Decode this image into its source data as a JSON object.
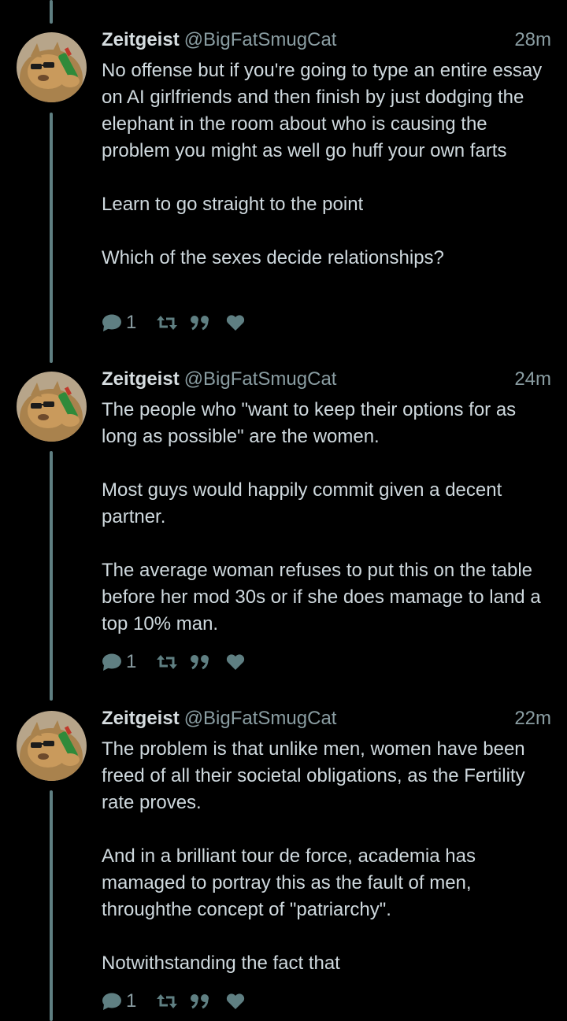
{
  "theme": {
    "background": "#000000",
    "text": "#cfd9de",
    "muted": "#8a9da2",
    "accent": "#5f7f82"
  },
  "posts": [
    {
      "author": "Zeitgeist",
      "handle": "@BigFatSmugCat",
      "time": "28m",
      "paragraphs": [
        "No offense but if you're going to type an entire essay on AI girlfriends and then finish by just dodging the elephant in the room about who is causing the problem you might as well go huff your own farts",
        "Learn to go straight to the point",
        "Which of the sexes decide relationships?"
      ],
      "reply_count": "1",
      "icons": [
        "reply-icon",
        "repeat-icon",
        "quote-icon",
        "heart-icon"
      ]
    },
    {
      "author": "Zeitgeist",
      "handle": "@BigFatSmugCat",
      "time": "24m",
      "paragraphs": [
        "The people who \"want to keep their options for as long as possible\" are the women.",
        "Most guys would happily commit given a decent partner.",
        "The average woman refuses to put this on the table before her mod 30s or if she does mamage to land a top 10% man."
      ],
      "reply_count": "1",
      "icons": [
        "reply-icon",
        "repeat-icon",
        "quote-icon",
        "heart-icon"
      ]
    },
    {
      "author": "Zeitgeist",
      "handle": "@BigFatSmugCat",
      "time": "22m",
      "paragraphs": [
        "The problem is that unlike men, women have been freed of all their societal obligations, as the Fertility rate proves.",
        "And in a brilliant tour de force, academia has mamaged to portray this as the fault of men, throughthe concept of \"patriarchy\".",
        "Notwithstanding the fact that"
      ],
      "reply_count": "1",
      "icons": [
        "reply-icon",
        "repeat-icon",
        "quote-icon",
        "heart-icon"
      ]
    }
  ]
}
